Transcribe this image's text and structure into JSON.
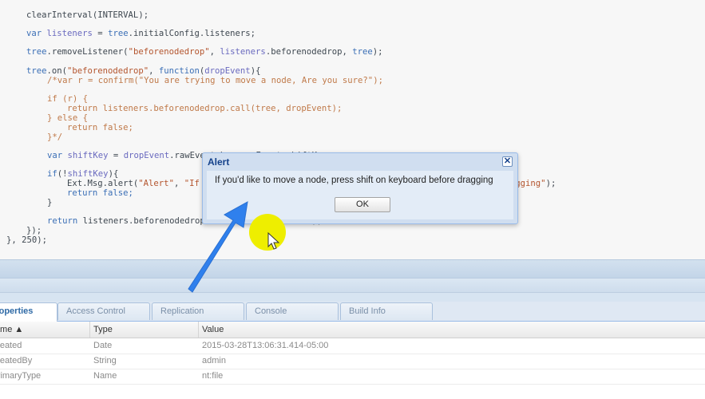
{
  "code": {
    "lines": [
      [
        {
          "t": "clearInterval(INTERVAL);",
          "c": "plain"
        }
      ],
      [
        {
          "t": "var ",
          "c": "kw"
        },
        {
          "t": "listeners",
          "c": "var"
        },
        {
          "t": " = ",
          "c": "plain"
        },
        {
          "t": "tree",
          "c": "kw"
        },
        {
          "t": ".initialConfig.listeners;",
          "c": "plain"
        }
      ],
      [
        {
          "t": "tree",
          "c": "kw"
        },
        {
          "t": ".removeListener(",
          "c": "plain"
        },
        {
          "t": "\"beforenodedrop\"",
          "c": "str"
        },
        {
          "t": ", ",
          "c": "plain"
        },
        {
          "t": "listeners",
          "c": "var"
        },
        {
          "t": ".beforenodedrop, ",
          "c": "plain"
        },
        {
          "t": "tree",
          "c": "kw"
        },
        {
          "t": ");",
          "c": "plain"
        }
      ],
      [
        {
          "t": "tree",
          "c": "kw"
        },
        {
          "t": ".on(",
          "c": "plain"
        },
        {
          "t": "\"beforenodedrop\"",
          "c": "str"
        },
        {
          "t": ", ",
          "c": "plain"
        },
        {
          "t": "function",
          "c": "kw"
        },
        {
          "t": "(",
          "c": "plain"
        },
        {
          "t": "dropEvent",
          "c": "var"
        },
        {
          "t": "){",
          "c": "plain"
        }
      ],
      [
        {
          "t": "/*var r = confirm(\"You are trying to move a node, Are you sure?\");",
          "c": "com"
        }
      ],
      [
        {
          "t": "if (r) {",
          "c": "com"
        }
      ],
      [
        {
          "t": "return listeners.beforenodedrop.call(tree, dropEvent);",
          "c": "com"
        }
      ],
      [
        {
          "t": "} else {",
          "c": "com"
        }
      ],
      [
        {
          "t": "return false;",
          "c": "com"
        }
      ],
      [
        {
          "t": "}*/",
          "c": "com"
        }
      ],
      [
        {
          "t": "var ",
          "c": "kw"
        },
        {
          "t": "shiftKey",
          "c": "var"
        },
        {
          "t": " = ",
          "c": "plain"
        },
        {
          "t": "dropEvent",
          "c": "var"
        },
        {
          "t": ".rawEvent.browserEvent.shiftKey;",
          "c": "plain"
        }
      ],
      [
        {
          "t": "if",
          "c": "kw"
        },
        {
          "t": "(!",
          "c": "plain"
        },
        {
          "t": "shiftKey",
          "c": "var"
        },
        {
          "t": "){",
          "c": "plain"
        }
      ],
      [
        {
          "t": "Ext.Msg.alert(",
          "c": "plain"
        },
        {
          "t": "\"Alert\"",
          "c": "str"
        },
        {
          "t": ", ",
          "c": "plain"
        },
        {
          "t": "\"If you'd like to move a node, press shift on keyboard before dragging\"",
          "c": "str"
        },
        {
          "t": ");",
          "c": "plain"
        }
      ],
      [
        {
          "t": "return ",
          "c": "kw"
        },
        {
          "t": "false;",
          "c": "kw"
        }
      ],
      [
        {
          "t": "}",
          "c": "plain"
        }
      ],
      [
        {
          "t": "return ",
          "c": "kw"
        },
        {
          "t": "listeners.beforenodedrop.call(tree, dropEvent);",
          "c": "plain"
        }
      ],
      [
        {
          "t": "});",
          "c": "plain"
        }
      ],
      [
        {
          "t": "}, 250);",
          "c": "plain"
        }
      ]
    ]
  },
  "tabs": [
    {
      "label": "Properties",
      "active": true
    },
    {
      "label": "Access Control",
      "active": false
    },
    {
      "label": "Replication",
      "active": false
    },
    {
      "label": "Console",
      "active": false
    },
    {
      "label": "Build Info",
      "active": false
    }
  ],
  "grid": {
    "columns": [
      "Name ▲",
      "Type",
      "Value"
    ],
    "rows": [
      {
        "name": "jcr:created",
        "type": "Date",
        "value": "2015-03-28T13:06:31.414-05:00"
      },
      {
        "name": "jcr:createdBy",
        "type": "String",
        "value": "admin"
      },
      {
        "name": "jcr:primaryType",
        "type": "Name",
        "value": "nt:file"
      }
    ]
  },
  "dialog": {
    "title": "Alert",
    "close_glyph": "✕",
    "message": "If you'd like to move a node, press shift on keyboard before dragging",
    "ok_label": "OK"
  },
  "annotation": {
    "arrow_color": "#2f80ed",
    "halo_color": "#eeee00"
  }
}
